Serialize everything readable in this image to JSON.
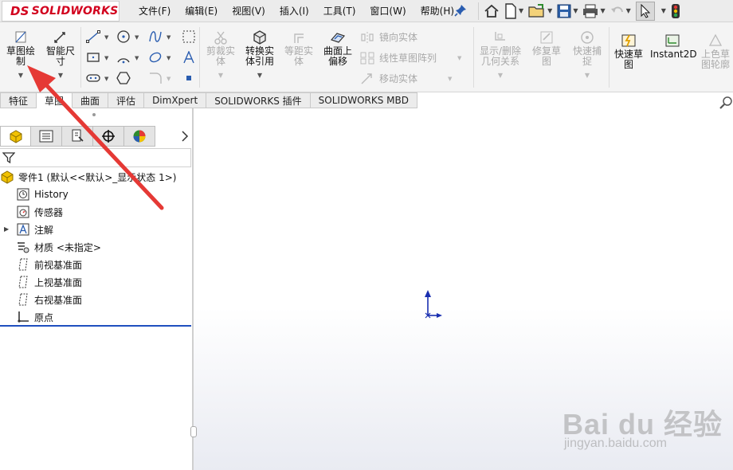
{
  "app": {
    "logo_text": "SOLIDWORKS",
    "logo_mark": "DS"
  },
  "menu": {
    "items": [
      "文件(F)",
      "编辑(E)",
      "视图(V)",
      "插入(I)",
      "工具(T)",
      "窗口(W)",
      "帮助(H)"
    ]
  },
  "ribbon": {
    "sketch": "草图绘制",
    "smart_dim": "智能尺寸",
    "trim": "剪裁实体",
    "convert": "转换实体引用",
    "offset_entity": "等距实体",
    "surface_offset": "曲面上偏移",
    "mirror": "镜向实体",
    "linear_pattern": "线性草图阵列",
    "move": "移动实体",
    "display_delete": "显示/删除几何关系",
    "repair": "修复草图",
    "quick_snap": "快速捕捉",
    "rapid_sketch": "快速草图",
    "instant2d": "Instant2D",
    "shaded_contours": "上色草图轮廓"
  },
  "tabs": [
    "特征",
    "草图",
    "曲面",
    "评估",
    "DimXpert",
    "SOLIDWORKS 插件",
    "SOLIDWORKS MBD"
  ],
  "active_tab": "草图",
  "tree": {
    "root": "零件1  (默认<<默认>_显示状态 1>)",
    "items": [
      "History",
      "传感器",
      "注解",
      "材质 <未指定>",
      "前视基准面",
      "上视基准面",
      "右视基准面",
      "原点"
    ]
  },
  "watermark": {
    "brand": "Bai du 经验",
    "url": "jingyan.baidu.com"
  },
  "colors": {
    "brand_red": "#d2001e",
    "tree_rule": "#1f4fbf",
    "annotation_arrow": "#e53935",
    "origin_blue": "#1a2fb0"
  }
}
